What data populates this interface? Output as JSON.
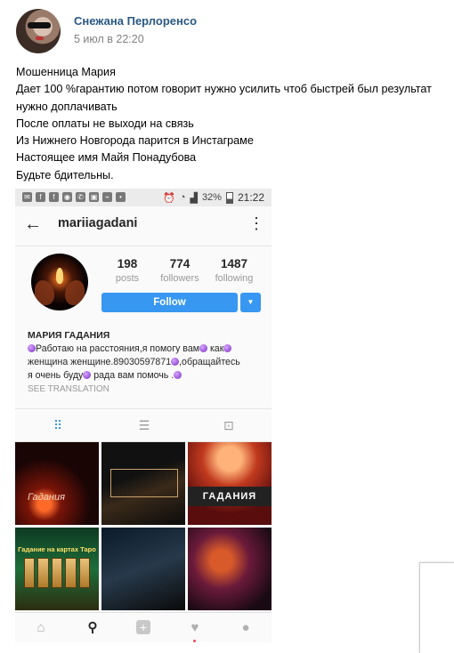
{
  "post": {
    "author": "Снежана Перлоренсо",
    "date": "5 июл в 22:20",
    "lines": [
      "Мошенница Мария",
      "Дает 100 %гарантию потом говорит нужно усилить чтоб быстрей был результат",
      "нужно доплачивать",
      "После оплаты не выходи на связь",
      "Из Нижнего Новгорода парится в Инстаграме",
      "Настоящее имя Майя Понадубова",
      "Будьте бдительны."
    ]
  },
  "screenshot": {
    "statusbar": {
      "battery": "32%",
      "time": "21:22"
    },
    "username": "mariiagadani",
    "stats": [
      {
        "num": "198",
        "label": "posts"
      },
      {
        "num": "774",
        "label": "followers"
      },
      {
        "num": "1487",
        "label": "following"
      }
    ],
    "follow_label": "Follow",
    "bio_name": "МАРИЯ ГАДАНИЯ",
    "bio_parts": {
      "l1a": "Работаю на расстояния,я помогу вам",
      "l1b": " как",
      "l2a": "женщина женщине.89030597871",
      "l2b": ",обращайтесь",
      "l3a": "я очень буду",
      "l3b": " рада вам помочь ."
    },
    "see_translation": "SEE TRANSLATION",
    "photos": {
      "p1_title": "Гадания",
      "p3_banner": "ГАДАНИЯ",
      "p4_title": "Гадание на картах Таро"
    }
  }
}
